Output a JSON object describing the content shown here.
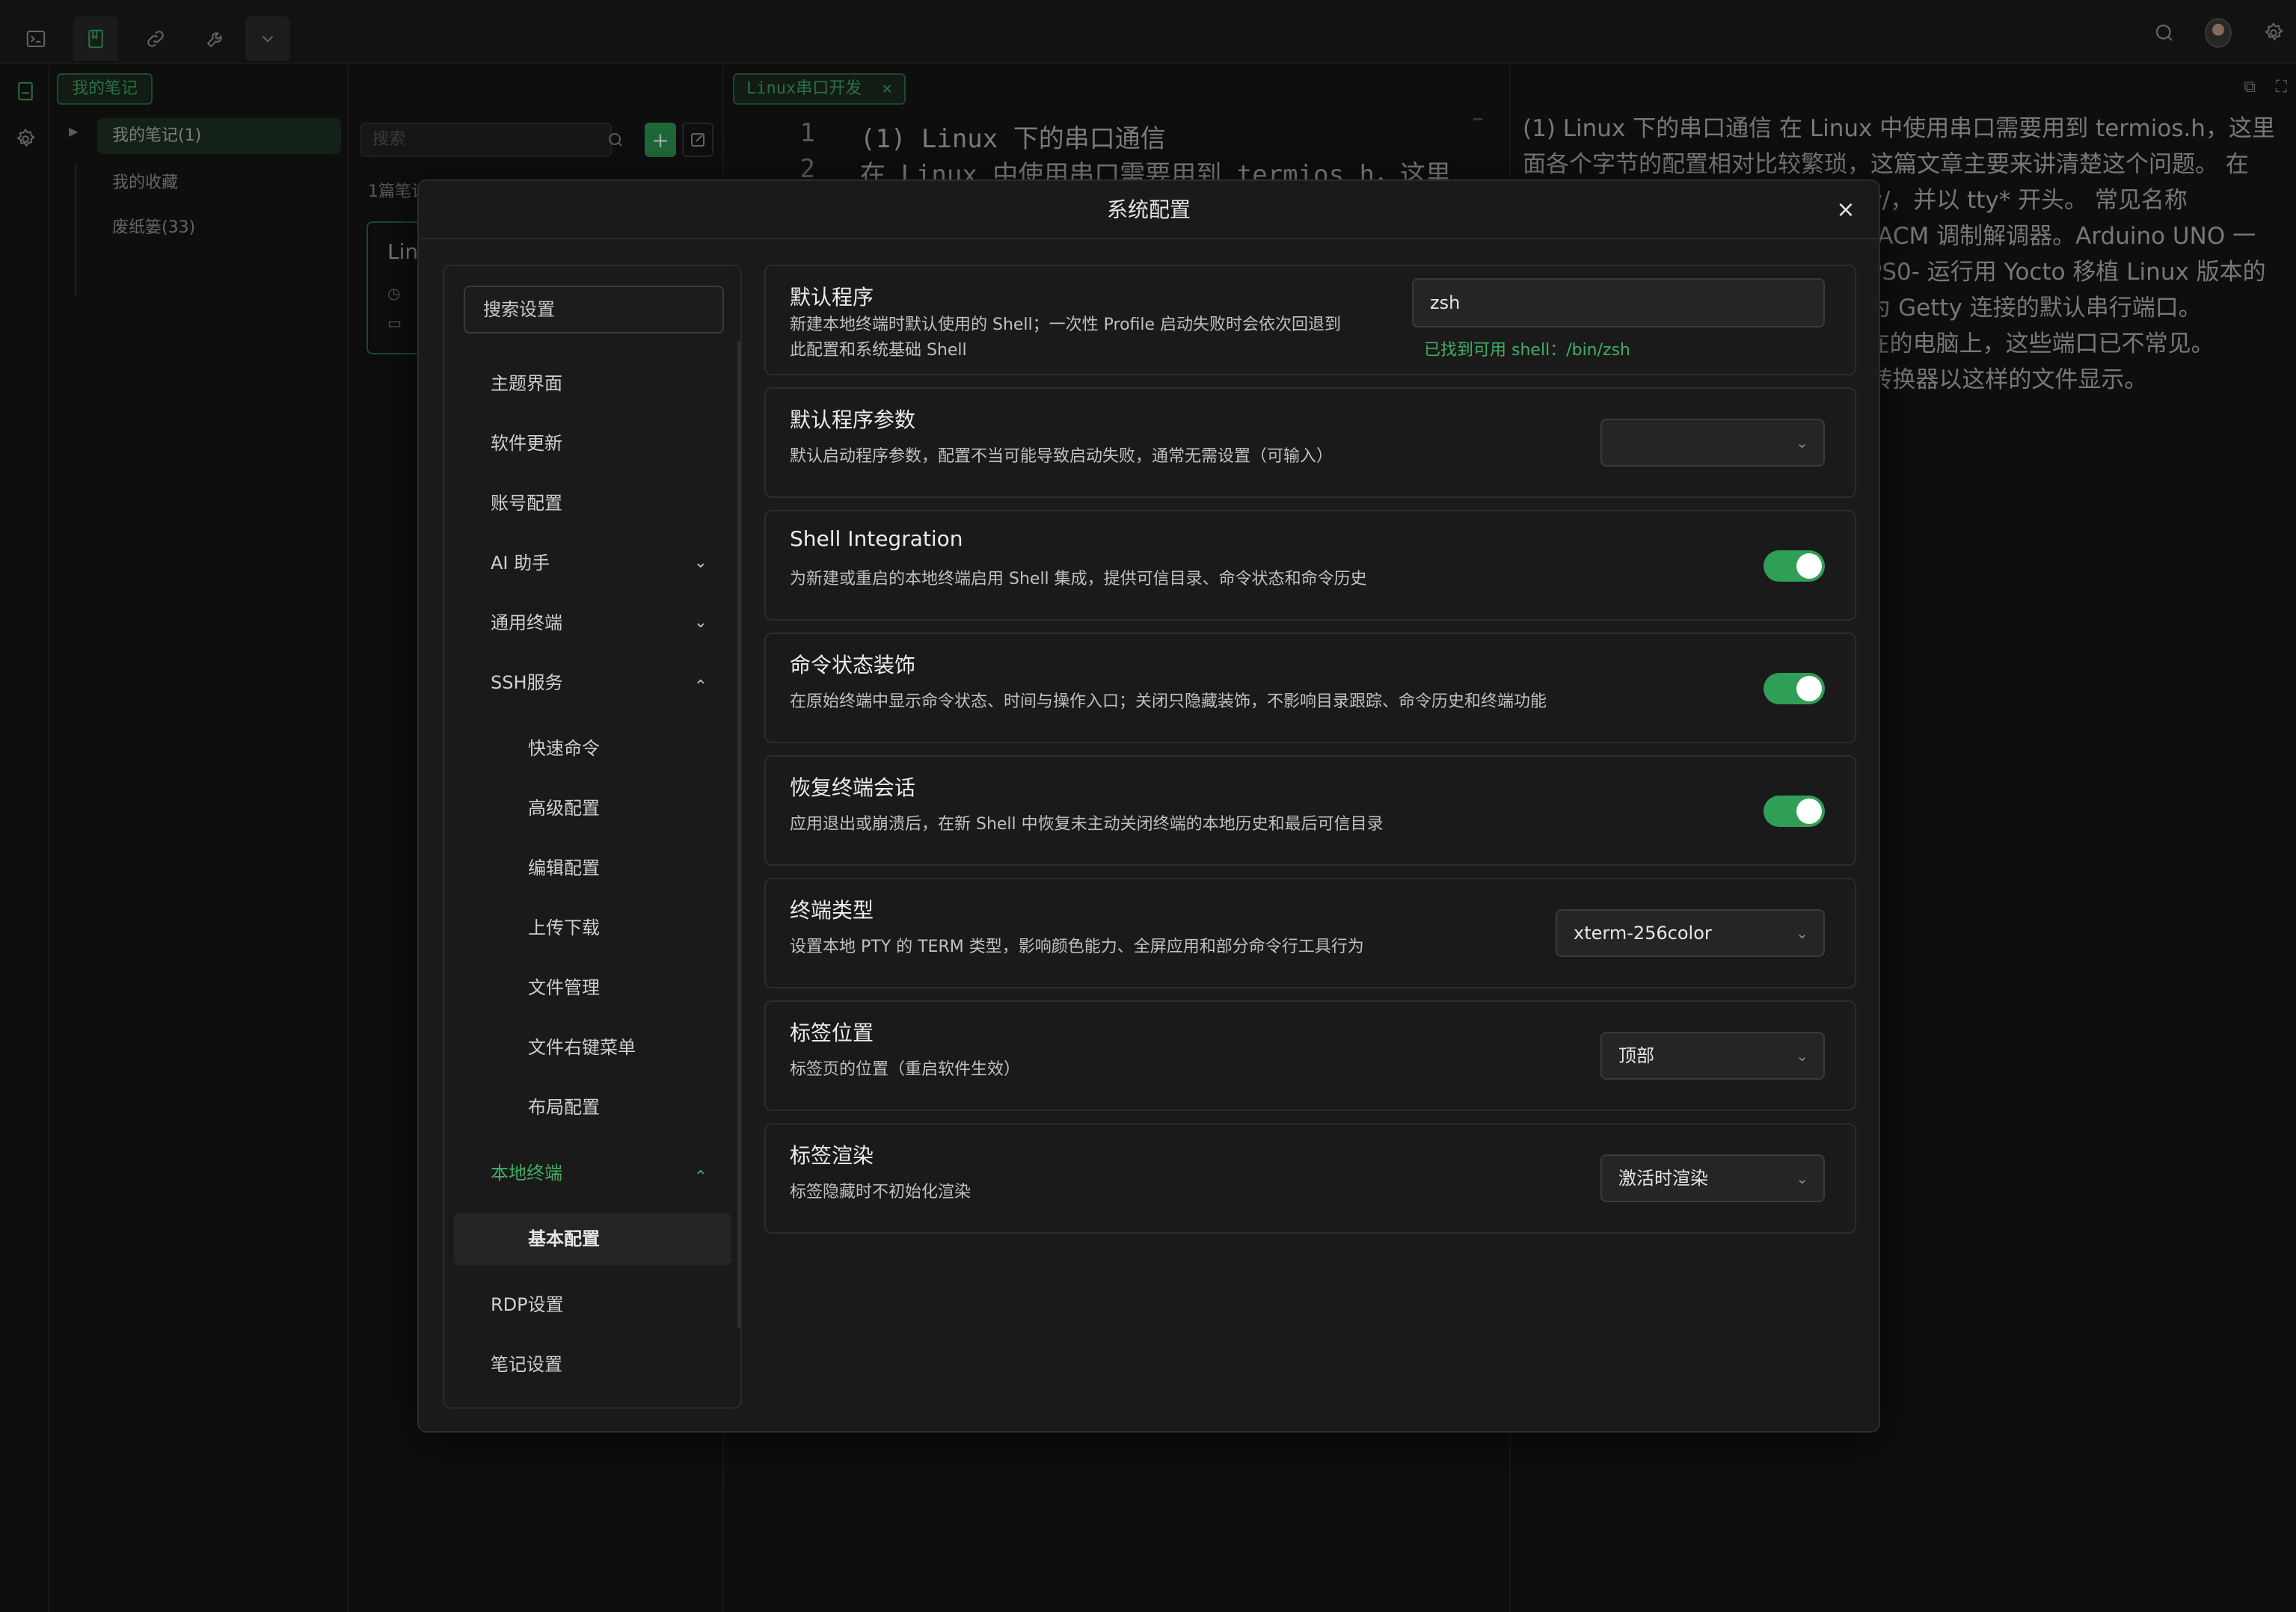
{
  "topbar": {
    "tabs": [
      {
        "icon": "terminal-icon"
      },
      {
        "icon": "notebook-icon",
        "active": true
      },
      {
        "icon": "link-icon"
      },
      {
        "icon": "wrench-icon"
      },
      {
        "icon": "chevron-down-icon"
      }
    ],
    "right_icons": [
      "search-icon",
      "avatar",
      "settings-icon"
    ]
  },
  "rail": {
    "icons": [
      "notebook-icon",
      "settings-icon"
    ]
  },
  "tree": {
    "tab_label": "我的笔记",
    "items": [
      {
        "label": "我的笔记(1)",
        "selected": true
      },
      {
        "label": "我的收藏"
      },
      {
        "label": "废纸篓(33)"
      }
    ]
  },
  "notelist": {
    "search_placeholder": "搜索",
    "count_label": "1篇笔记",
    "card_title": "Lin"
  },
  "editor": {
    "tab_label": "Linux串口开发",
    "lines": [
      {
        "no": "1",
        "text": "(1) Linux 下的串口通信"
      },
      {
        "no": "2",
        "text": "在 Linux 中使用串口需要用到 termios.h，这里"
      }
    ]
  },
  "preview": {
    "text": "(1) Linux 下的串口通信 在 Linux 中使用串口需要用到 termios.h，这里面各个字节的配置相对比较繁琐，这篇文章主要来讲清楚这个问题。 在 Linux 中，串口设备文件位于 /dev/，并以 tty* 开头。 常见名称有：/dev/ttyACM0- ACM 是指的 ACM 调制解调器。Arduino UNO 一类的设备使用这个名字。/dev/ttyPS0- 运行用 Yocto 移植 Linux 版本的 Xilinx Zynq FPGA 用这个名字作为 Getty 连接的默认串行端口。 /dev/ttyS0- 标准 COM 端口。现在的电脑上，这些端口已不常见。 /dev/ttyUSB0- 大部分 USB 串口转换器以这样的文件显示。 /dev/pts/0- 伪终"
  },
  "modal": {
    "title": "系统配置",
    "close_glyph": "×",
    "search_placeholder": "搜索设置",
    "nav": [
      {
        "label": "主题界面",
        "level": 0
      },
      {
        "label": "软件更新",
        "level": 0
      },
      {
        "label": "账号配置",
        "level": 0
      },
      {
        "label": "AI 助手",
        "level": 0,
        "chevron": "⌄"
      },
      {
        "label": "通用终端",
        "level": 0,
        "chevron": "⌄"
      },
      {
        "label": "SSH服务",
        "level": 0,
        "chevron": "⌃"
      },
      {
        "label": "快速命令",
        "level": 1
      },
      {
        "label": "高级配置",
        "level": 1
      },
      {
        "label": "编辑配置",
        "level": 1
      },
      {
        "label": "上传下载",
        "level": 1
      },
      {
        "label": "文件管理",
        "level": 1
      },
      {
        "label": "文件右键菜单",
        "level": 1
      },
      {
        "label": "布局配置",
        "level": 1
      },
      {
        "label": "本地终端",
        "level": 0,
        "chevron": "⌃",
        "green": true
      },
      {
        "label": "基本配置",
        "level": 1,
        "active": true
      },
      {
        "label": "RDP设置",
        "level": 0
      },
      {
        "label": "笔记设置",
        "level": 0
      }
    ],
    "settings": [
      {
        "title": "默认程序",
        "desc_line1": "新建本地终端时默认使用的 Shell；一次性 Profile 启动失败时会依次回退到",
        "desc_line2": "此配置和系统基础 Shell",
        "input_value": "zsh",
        "hint": "已找到可用 shell：/bin/zsh"
      },
      {
        "title": "默认程序参数",
        "desc": "默认启动程序参数，配置不当可能导致启动失败，通常无需设置（可输入）",
        "select_value": ""
      },
      {
        "title": "Shell Integration",
        "desc": "为新建或重启的本地终端启用 Shell 集成，提供可信目录、命令状态和命令历史",
        "toggle": true
      },
      {
        "title": "命令状态装饰",
        "desc": "在原始终端中显示命令状态、时间与操作入口；关闭只隐藏装饰，不影响目录跟踪、命令历史和终端功能",
        "toggle": true
      },
      {
        "title": "恢复终端会话",
        "desc": "应用退出或崩溃后，在新 Shell 中恢复未主动关闭终端的本地历史和最后可信目录",
        "toggle": true
      },
      {
        "title": "终端类型",
        "desc": "设置本地 PTY 的 TERM 类型，影响颜色能力、全屏应用和部分命令行工具行为",
        "select_value": "xterm-256color"
      },
      {
        "title": "标签位置",
        "desc": "标签页的位置（重启软件生效）",
        "select_value": "顶部"
      },
      {
        "title": "标签渲染",
        "desc": "标签隐藏时不初始化渲染",
        "select_value": "激活时渲染"
      }
    ]
  },
  "colors": {
    "accent_green": "#3fae63",
    "toggle_on": "#2f9e57",
    "background": "#161616",
    "modal_bg": "#1a1a1a"
  }
}
